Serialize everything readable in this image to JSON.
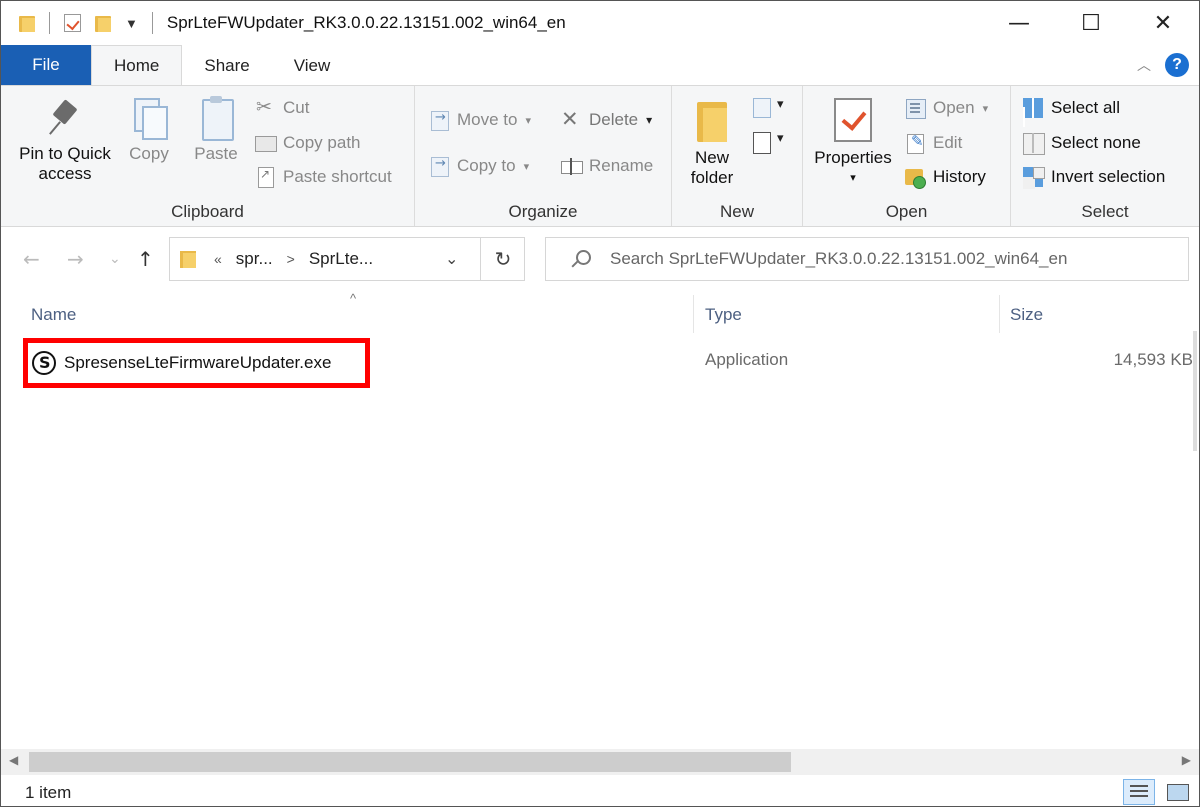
{
  "window": {
    "title": "SprLteFWUpdater_RK3.0.0.22.13151.002_win64_en",
    "minimize": "—",
    "maximize": "☐",
    "close": "✕"
  },
  "tabs": [
    "File",
    "Home",
    "Share",
    "View"
  ],
  "ribbon": {
    "clipboard": {
      "label": "Clipboard",
      "pin_line1": "Pin to Quick",
      "pin_line2": "access",
      "copy": "Copy",
      "paste": "Paste",
      "cut": "Cut",
      "copy_path": "Copy path",
      "paste_shortcut": "Paste shortcut"
    },
    "organize": {
      "label": "Organize",
      "move_to": "Move to",
      "copy_to": "Copy to",
      "delete": "Delete",
      "rename": "Rename"
    },
    "new": {
      "label": "New",
      "new_line1": "New",
      "new_line2": "folder"
    },
    "open": {
      "label": "Open",
      "properties": "Properties",
      "open": "Open",
      "edit": "Edit",
      "history": "History"
    },
    "select": {
      "label": "Select",
      "select_all": "Select all",
      "select_none": "Select none",
      "invert_selection": "Invert selection"
    }
  },
  "address": {
    "crumb_prefix": "«",
    "crumb1": "spr...",
    "crumb_sep": ">",
    "crumb2": "SprLte...",
    "search_placeholder": "Search SprLteFWUpdater_RK3.0.0.22.13151.002_win64_en"
  },
  "columns": {
    "name": "Name",
    "type": "Type",
    "size": "Size"
  },
  "files": [
    {
      "name": "SpresenseLteFirmwareUpdater.exe",
      "type": "Application",
      "size": "14,593 KB"
    }
  ],
  "status": {
    "item_count": "1 item"
  },
  "colors": {
    "file_tab": "#1a5fb4",
    "highlight_box": "#ff0000",
    "ribbon_bg": "#f5f6f7",
    "column_header": "#4d6082"
  }
}
